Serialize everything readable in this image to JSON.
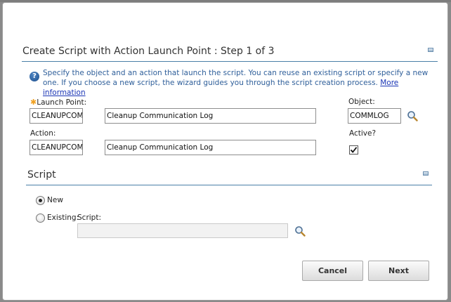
{
  "dialog": {
    "title": "Create Script with Action Launch Point : Step 1 of 3",
    "info_text": "Specify the object and an action that launch the script. You can reuse an existing script or specify a new one. If you choose a new script, the wizard guides you through the script creation process.",
    "more_info_link": "More information"
  },
  "launch_point": {
    "label": "Launch Point:",
    "value": "CLEANUPCOMI",
    "description": "Cleanup Communication Log"
  },
  "object": {
    "label": "Object:",
    "value": "COMMLOG"
  },
  "action": {
    "label": "Action:",
    "value": "CLEANUPCOMI",
    "description": "Cleanup Communication Log"
  },
  "active": {
    "label": "Active?",
    "checked": true
  },
  "script_section": {
    "title": "Script",
    "new_label": "New",
    "existing_label": "Existing:",
    "script_label": "Script:",
    "script_value": "",
    "selected": "new"
  },
  "buttons": {
    "cancel": "Cancel",
    "next": "Next"
  },
  "icons": [
    "help-icon",
    "collapse-icon",
    "search-icon",
    "checkmark-icon",
    "required-star-icon"
  ],
  "colors": {
    "accent_rule": "#4a7fa8",
    "info_text": "#2f5f9a",
    "link": "#1a35b5",
    "required_star": "#f0a020"
  }
}
